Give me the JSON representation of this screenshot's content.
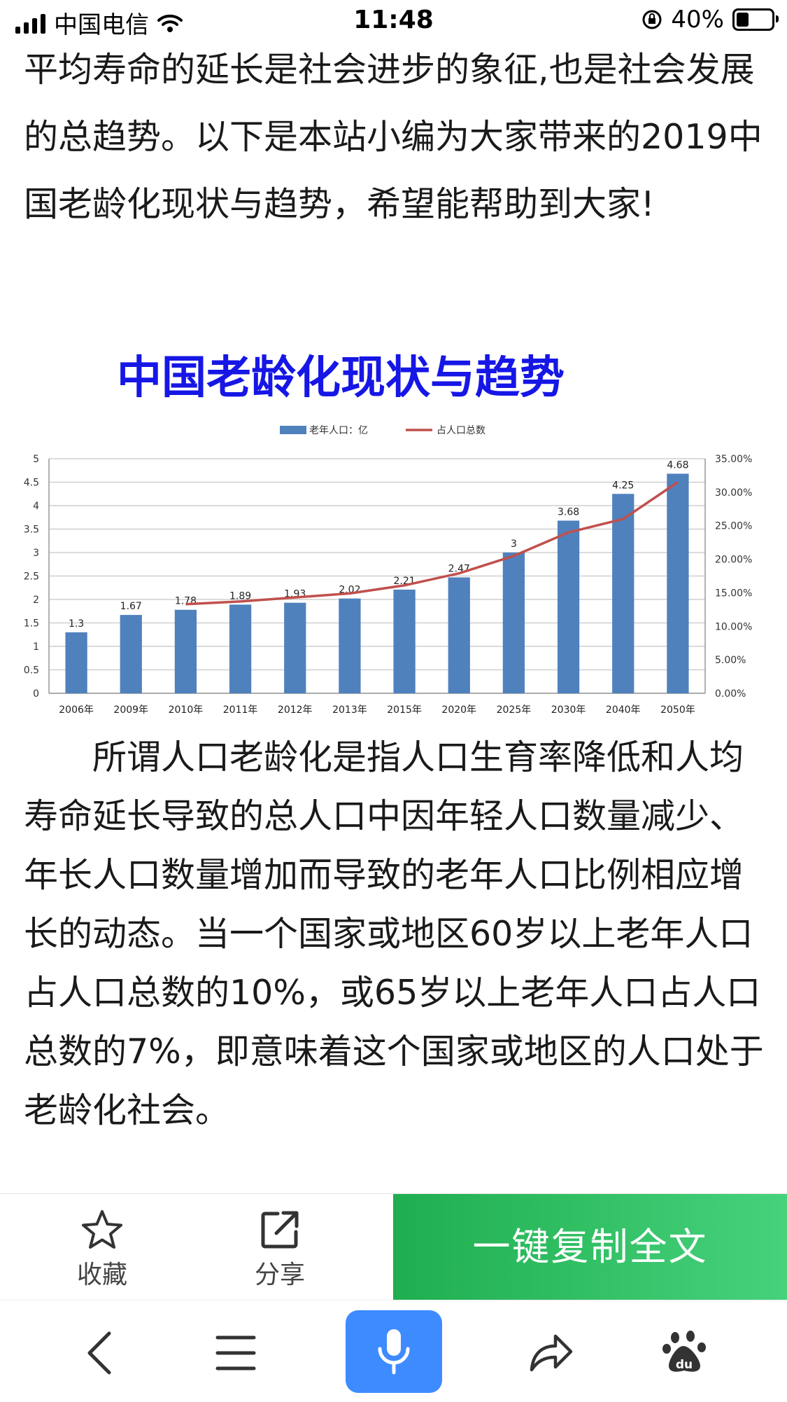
{
  "status_bar": {
    "carrier": "中国电信",
    "time": "11:48",
    "battery": "40%"
  },
  "article": {
    "paragraph1": "平均寿命的延长是社会进步的象征,也是社会发展的总趋势。以下是本站小编为大家带来的2019中国老龄化现状与趋势，希望能帮助到大家!",
    "chart_title": "中国老龄化现状与趋势",
    "paragraph2": "所谓人口老龄化是指人口生育率降低和人均寿命延长导致的总人口中因年轻人口数量减少、年长人口数量增加而导致的老年人口比例相应增长的动态。当一个国家或地区60岁以上老年人口占人口总数的10%，或65岁以上老年人口占人口总数的7%，即意味着这个国家或地区的人口处于老龄化社会。"
  },
  "chart_data": {
    "type": "bar",
    "categories": [
      "2006年",
      "2009年",
      "2010年",
      "2011年",
      "2012年",
      "2013年",
      "2015年",
      "2020年",
      "2025年",
      "2030年",
      "2040年",
      "2050年"
    ],
    "series": [
      {
        "name": "老年人口：亿",
        "type": "bar",
        "axis": "left",
        "values": [
          1.3,
          1.67,
          1.78,
          1.89,
          1.93,
          2.02,
          2.21,
          2.47,
          3,
          3.68,
          4.25,
          4.68
        ],
        "labels": [
          "1.3",
          "1.67",
          "1.78",
          "1.89",
          "1.93",
          "2.02",
          "2.21",
          "2.47",
          "3",
          "3.68",
          "4.25",
          "4.68"
        ]
      },
      {
        "name": "占人口总数",
        "type": "line",
        "axis": "right",
        "values": [
          null,
          null,
          13.3,
          13.7,
          14.3,
          14.9,
          16.1,
          17.9,
          20.5,
          24.0,
          26.0,
          31.5
        ]
      }
    ],
    "y_left": {
      "min": 0,
      "max": 5,
      "ticks": [
        "0",
        "0.5",
        "1",
        "1.5",
        "2",
        "2.5",
        "3",
        "3.5",
        "4",
        "4.5",
        "5"
      ]
    },
    "y_right": {
      "min": 0,
      "max": 35,
      "ticks": [
        "0.00%",
        "5.00%",
        "10.00%",
        "15.00%",
        "20.00%",
        "25.00%",
        "30.00%",
        "35.00%"
      ]
    },
    "grid": true,
    "legend_position": "top",
    "colors": {
      "bar": "#4f81bd",
      "line": "#c0504d"
    }
  },
  "action_bar": {
    "favorite_label": "收藏",
    "share_label": "分享",
    "copy_label": "一键复制全文"
  },
  "icons": {
    "back": "chevron-left-icon",
    "menu": "menu-icon",
    "voice": "microphone-icon",
    "forward": "share-arrow-icon",
    "baidu": "baidu-paw-icon"
  }
}
